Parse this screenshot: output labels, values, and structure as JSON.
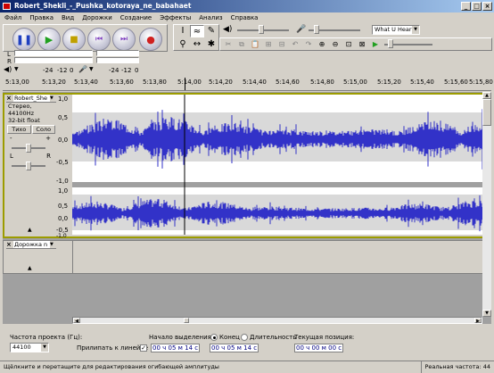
{
  "window": {
    "title": "Robert_Shekli_-_Pushka_kotoraya_ne_babahaet",
    "minimize": "_",
    "maximize": "□",
    "close": "×"
  },
  "menu": [
    "Файл",
    "Правка",
    "Вид",
    "Дорожки",
    "Создание",
    "Эффекты",
    "Анализ",
    "Справка"
  ],
  "meters": {
    "input_device": "What U Hear",
    "out_l": "L",
    "out_r": "R",
    "in_l": "L",
    "in_r": "R"
  },
  "left_meters": {
    "scale_a": "-24",
    "scale_b": "-12",
    "scale_c": "0",
    "scale_d": "-24",
    "scale_e": "-12",
    "scale_f": "0"
  },
  "ruler": [
    "5:13,00",
    "5:13,20",
    "5:13,40",
    "5:13,60",
    "5:13,80",
    "5:14,00",
    "5:14,20",
    "5:14,40",
    "5:14,60",
    "5:14,80",
    "5:15,00",
    "5:15,20",
    "5:15,40",
    "5:15,60",
    "5:15,80"
  ],
  "track1": {
    "name": "Robert_She",
    "info1": "Стерео, 44100Hz",
    "info2": "32-bit float",
    "mute": "Тихо",
    "solo": "Соло",
    "minus": "-",
    "plus": "+",
    "L": "L",
    "R": "R"
  },
  "scale": [
    "1,0",
    "0,5",
    "0,0",
    "-0,5",
    "-1,0",
    "1,0",
    "0,5",
    "0,0",
    "-0,5",
    "-1,0"
  ],
  "track2": {
    "name": "Дорожка n"
  },
  "bottom": {
    "rate_label": "Частота проекта (Гц):",
    "rate_value": "44100",
    "snap_label": "Прилипать к линейке",
    "sel_label": "Начало выделения:",
    "end_label": "Конец",
    "len_label": "Длительность",
    "sel_start": "00 ч 05 м 14 с",
    "sel_end": "00 ч 05 м 14 с",
    "pos_label": "Текущая позиция:",
    "pos_value": "00 ч 00 м 00 с"
  },
  "status": {
    "hint": "Щёлкните и перетащите для редактирования огибающей амплитуды",
    "rate": "Реальная частота: 44"
  },
  "colors": {
    "wave": "#3232c8",
    "wave_bg": "#ffffff",
    "selection": "#d9d9d9",
    "track_border": "#9c9c00"
  }
}
